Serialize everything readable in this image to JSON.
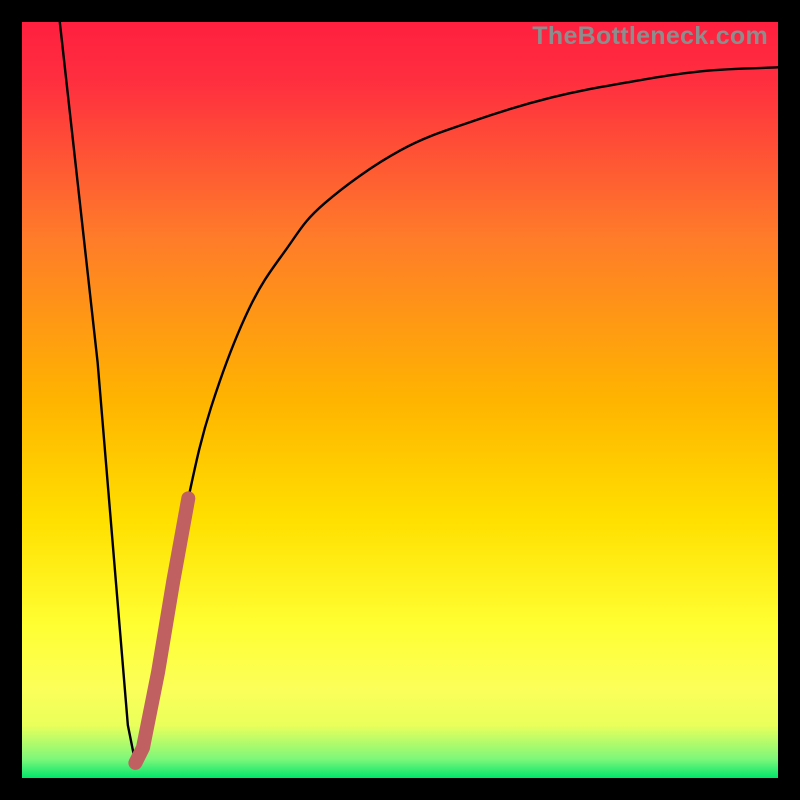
{
  "watermark": {
    "text": "TheBottleneck.com"
  },
  "colors": {
    "frame": "#000000",
    "gradient_top": "#ff1f3f",
    "gradient_mid_upper": "#ff7a2a",
    "gradient_mid": "#ffd400",
    "gradient_mid_lower": "#ffff33",
    "gradient_yellow_band": "#faff66",
    "gradient_green": "#00e66a",
    "curve": "#000000",
    "highlight": "#c16060"
  },
  "chart_data": {
    "type": "line",
    "title": "",
    "xlabel": "",
    "ylabel": "",
    "xlim": [
      0,
      100
    ],
    "ylim": [
      0,
      100
    ],
    "grid": false,
    "legend": null,
    "series": [
      {
        "name": "bottleneck_curve",
        "x": [
          5,
          10,
          14,
          15,
          16,
          18,
          20,
          22,
          25,
          30,
          35,
          40,
          50,
          60,
          70,
          80,
          90,
          100
        ],
        "y": [
          100,
          55,
          7,
          2,
          4,
          14,
          26,
          37,
          49,
          62,
          70,
          76,
          83,
          87,
          90,
          92,
          93.5,
          94
        ]
      },
      {
        "name": "highlight_segment",
        "x": [
          15,
          16,
          18,
          20,
          22
        ],
        "y": [
          2,
          4,
          14,
          26,
          37
        ]
      }
    ],
    "notes": "Curve resembles a bottleneck plot: steep drop from top-left to a minimum near x≈15, then an asymptotic rise toward ~94 on the right."
  }
}
